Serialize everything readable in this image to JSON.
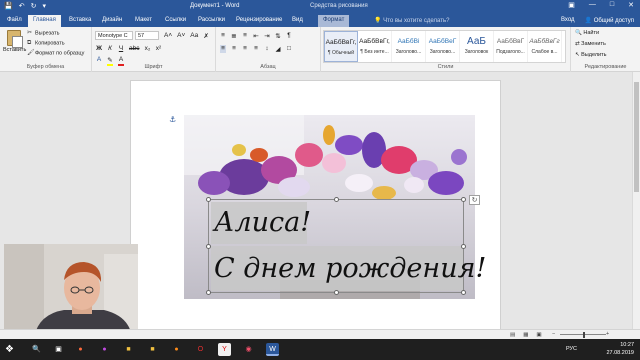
{
  "titlebar": {
    "doc_title": "Документ1 - Word",
    "context_title": "Средства рисования"
  },
  "tabs": [
    "Файл",
    "Главная",
    "Вставка",
    "Дизайн",
    "Макет",
    "Ссылки",
    "Рассылки",
    "Рецензирование",
    "Вид",
    "Формат"
  ],
  "tell_me": "Что вы хотите сделать?",
  "sign_in": "Вход",
  "share": "Общий доступ",
  "clipboard": {
    "paste": "Вставить",
    "cut": "Вырезать",
    "copy": "Копировать",
    "format_painter": "Формат по образцу",
    "label": "Буфер обмена"
  },
  "font": {
    "name": "Monotype C",
    "size": "57",
    "label": "Шрифт"
  },
  "paragraph": {
    "label": "Абзац"
  },
  "styles": {
    "label": "Стили",
    "items": [
      {
        "sample": "АаБбВвГг,",
        "name": "¶ Обычный"
      },
      {
        "sample": "АаБбВвГг,",
        "name": "¶ Без инте..."
      },
      {
        "sample": "АаБбВі",
        "name": "Заголово..."
      },
      {
        "sample": "АаБбВеГ",
        "name": "Заголово..."
      },
      {
        "sample": "АаБ",
        "name": "Заголовок"
      },
      {
        "sample": "АаБбВвГ",
        "name": "Подзаголо..."
      },
      {
        "sample": "АаБбВвГг",
        "name": "Слабое в..."
      }
    ]
  },
  "editing": {
    "find": "Найти",
    "replace": "Заменить",
    "select": "Выделить",
    "label": "Редактирование"
  },
  "textbox": {
    "line1": "Алиса!",
    "line2": "С днем рождения!"
  },
  "taskbar": {
    "time": "10:27",
    "date": "27.08.2019",
    "lang": "РУС"
  }
}
